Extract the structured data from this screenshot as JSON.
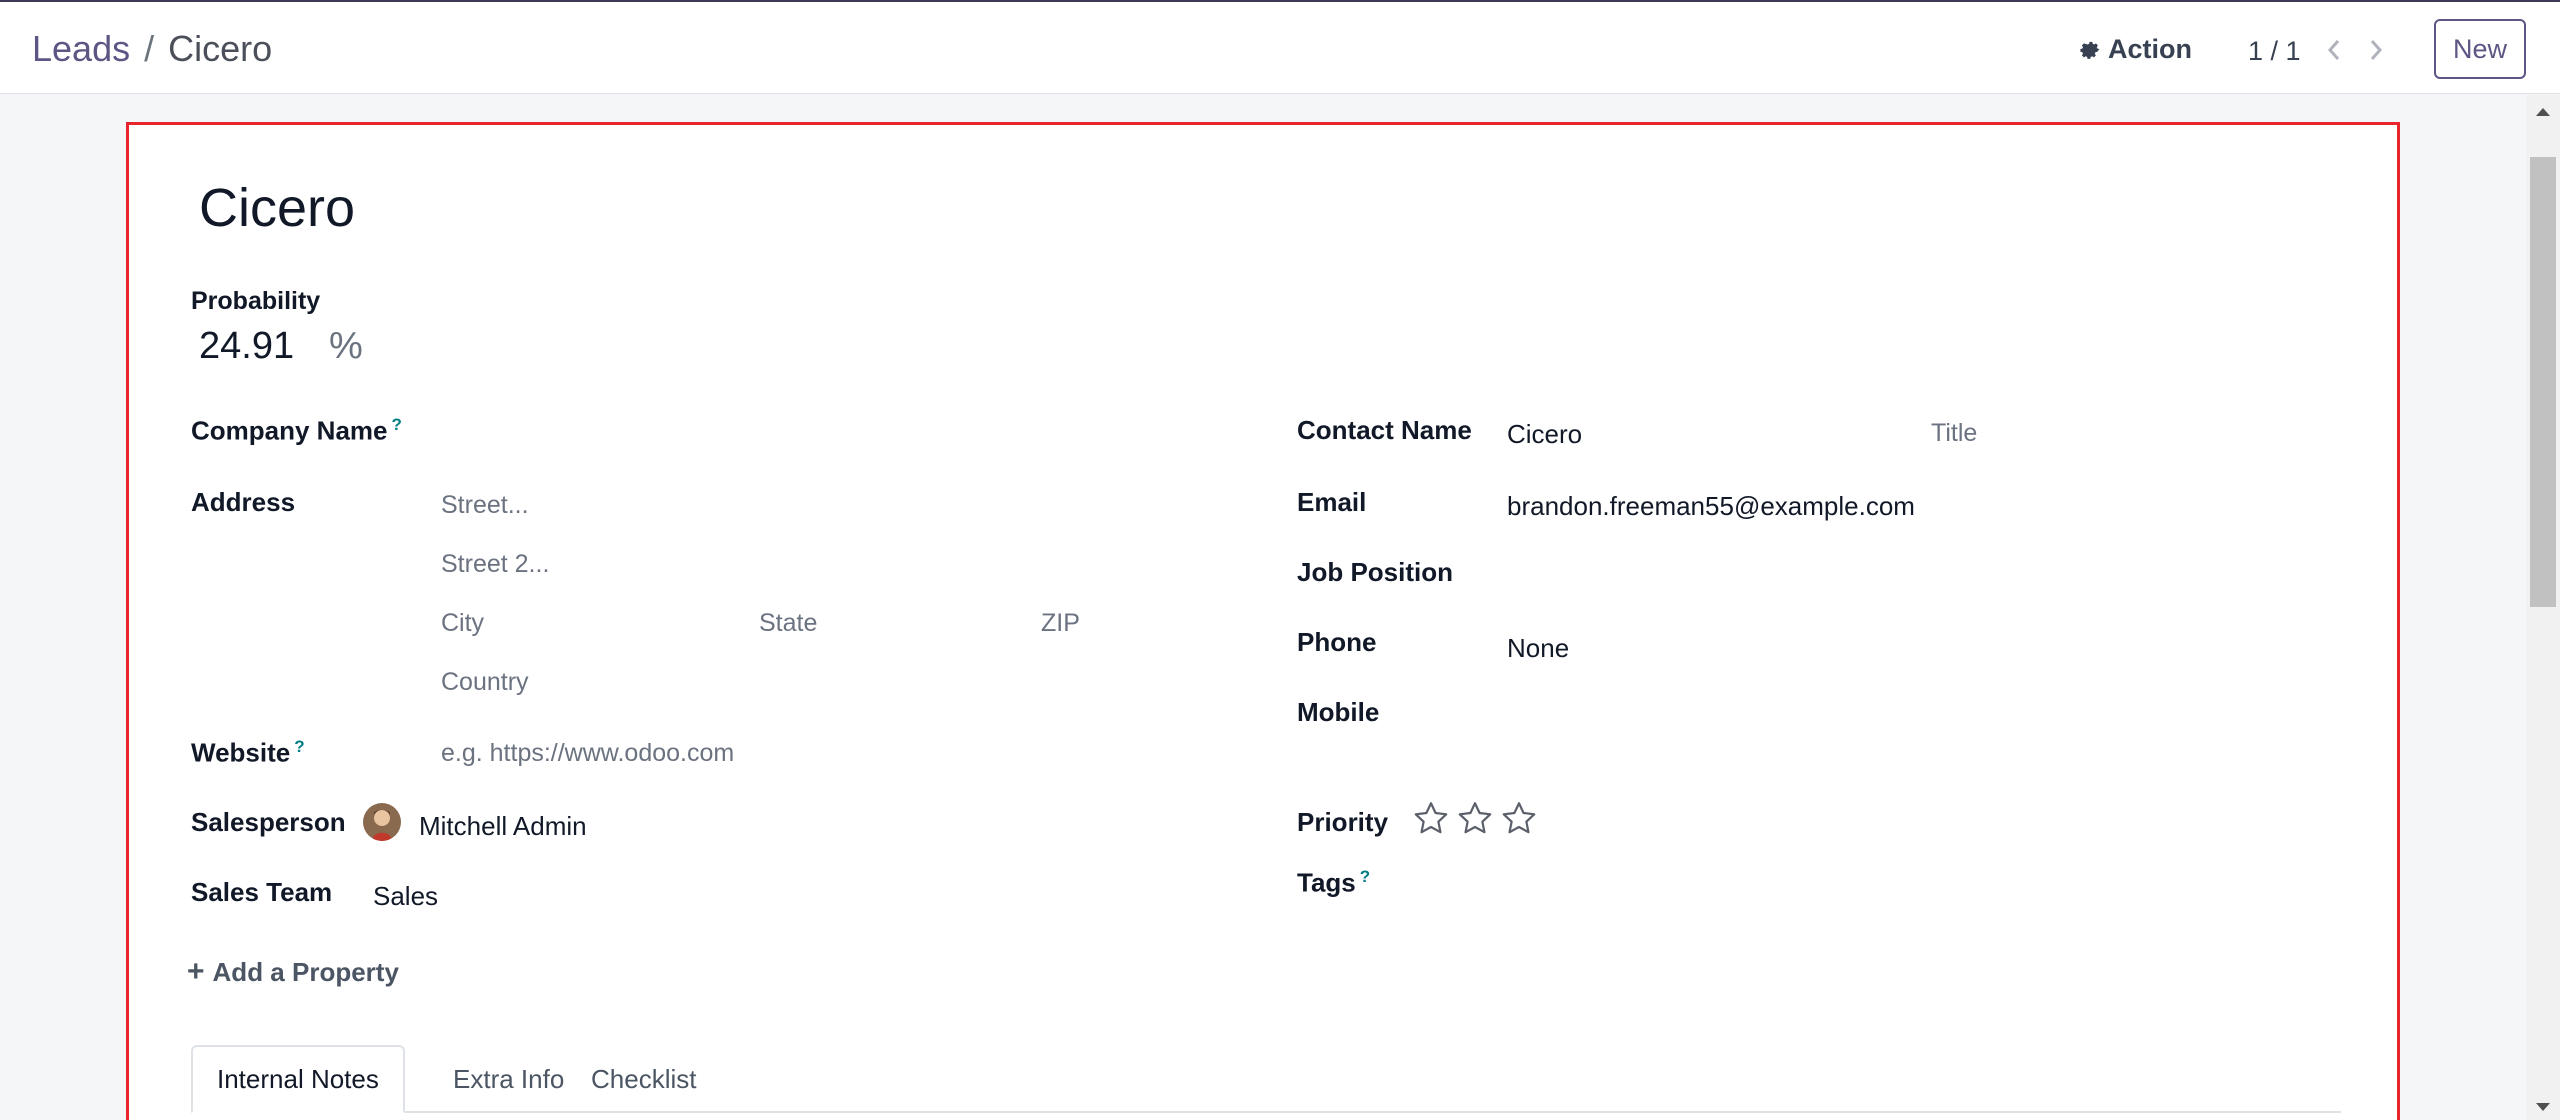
{
  "breadcrumb": {
    "parent": "Leads",
    "separator": "/",
    "current": "Cicero"
  },
  "toolbar": {
    "action_label": "Action",
    "pager": "1 / 1",
    "new_label": "New"
  },
  "form": {
    "title": "Cicero",
    "probability": {
      "label": "Probability",
      "value": "24.91",
      "unit": "%"
    },
    "left": {
      "company_name_label": "Company Name",
      "help_mark": "?",
      "address_label": "Address",
      "street_placeholder": "Street...",
      "street2_placeholder": "Street 2...",
      "city_placeholder": "City",
      "state_placeholder": "State",
      "zip_placeholder": "ZIP",
      "country_placeholder": "Country",
      "website_label": "Website",
      "website_placeholder": "e.g. https://www.odoo.com",
      "salesperson_label": "Salesperson",
      "salesperson_value": "Mitchell Admin",
      "sales_team_label": "Sales Team",
      "sales_team_value": "Sales"
    },
    "right": {
      "contact_name_label": "Contact Name",
      "contact_name_value": "Cicero",
      "title_placeholder": "Title",
      "email_label": "Email",
      "email_value": "brandon.freeman55@example.com",
      "job_position_label": "Job Position",
      "phone_label": "Phone",
      "phone_value": "None",
      "mobile_label": "Mobile",
      "priority_label": "Priority",
      "priority_stars": 0,
      "priority_max": 3,
      "tags_label": "Tags"
    },
    "add_property_label": "Add a Property",
    "tabs": [
      {
        "label": "Internal Notes",
        "active": true
      },
      {
        "label": "Extra Info",
        "active": false
      },
      {
        "label": "Checklist",
        "active": false
      }
    ]
  },
  "colors": {
    "accent": "#5c5684",
    "highlight_border": "#e8242c",
    "help_icon": "#017e84"
  },
  "icons": [
    "gear-icon",
    "chevron-left-icon",
    "chevron-right-icon",
    "plus-icon",
    "star-outline-icon",
    "scroll-up-icon",
    "scroll-down-icon"
  ]
}
